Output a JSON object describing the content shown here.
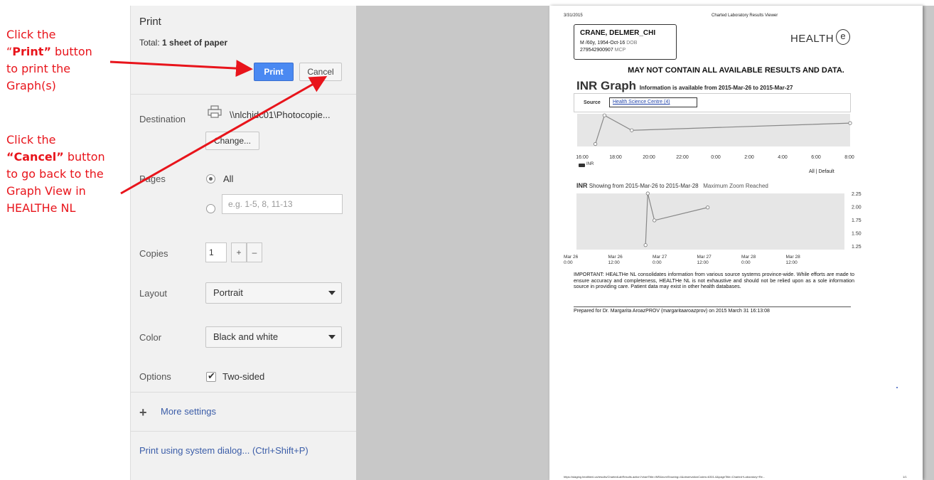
{
  "annotations": {
    "print_note": {
      "line1": "Click the",
      "line2_pre": "“",
      "line2_bold": "Print”",
      "line2_post": " button",
      "line3": "to print the",
      "line4": "Graph(s)"
    },
    "cancel_note": {
      "line1": "Click the",
      "line2_bold": "“Cancel”",
      "line2_post": " button",
      "line3": "to go back to the",
      "line4": "Graph View in",
      "line5": "HEALTHe NL"
    },
    "color": "#e8141b"
  },
  "print_panel": {
    "title": "Print",
    "total_prefix": "Total: ",
    "total_value": "1 sheet of paper",
    "print_button": "Print",
    "cancel_button": "Cancel",
    "destination_label": "Destination",
    "destination_value": "\\\\nlchidc01\\Photocopie...",
    "change_button": "Change...",
    "pages_label": "Pages",
    "pages_all": "All",
    "pages_placeholder": "e.g. 1-5, 8, 11-13",
    "copies_label": "Copies",
    "copies_value": "1",
    "copies_plus": "+",
    "copies_minus": "–",
    "layout_label": "Layout",
    "layout_value": "Portrait",
    "color_label": "Color",
    "color_value": "Black and white",
    "options_label": "Options",
    "options_two_sided": "Two-sided",
    "more_settings": "More settings",
    "system_dialog": "Print using system dialog... (Ctrl+Shift+P)",
    "accent_color": "#4a89f2"
  },
  "paper": {
    "date": "3/31/2015",
    "header_title": "Charted Laboratory Results Viewer",
    "patient_name": "CRANE, DELMER_CHI",
    "patient_info": "M /60y, 1954-Oct-16",
    "patient_info_suffix": "DOB",
    "patient_id": "279542900907",
    "patient_id_suffix": "MCP",
    "logo": "HEALTH",
    "logo_e": "e",
    "warning": "MAY NOT CONTAIN ALL AVAILABLE RESULTS AND DATA.",
    "graph_title": "INR Graph",
    "graph_subtitle": "Information is available from 2015-Mar-26 to 2015-Mar-27",
    "source_label": "Source",
    "source_value": "Health Science Centre (4)",
    "legend_inr": "INR",
    "all_default": "All | Default",
    "zoom_title_bold": "INR",
    "zoom_title": "Showing from 2015-Mar-26 to 2015-Mar-28",
    "zoom_note": "Maximum Zoom Reached",
    "important": "IMPORTANT: HEALTHe NL consolidates information from various source systems province-wide. While efforts are made to ensure accuracy and completeness, HEALTHe NL is not exhaustive and should not be relied upon as a sole information source in providing care. Patient data may exist in other health databases.",
    "prepared": "Prepared for Dr. Margarita AroazPROV (margaritaaroazprov) on 2015 March 31 16:13:08",
    "footer_url": "https://staging.healthenl.ca/results/ChartedLabResults.action?chartTitle=INR&numShowing=4&observationCodes=6301-6&pageTitle=Charted+Laboratory+Re...",
    "footer_page": "1/1"
  },
  "chart_data": [
    {
      "type": "line",
      "title": "INR Graph",
      "x_tick_labels": [
        "16:00",
        "18:00",
        "20:00",
        "22:00",
        "0:00",
        "2:00",
        "4:00",
        "6:00",
        "8:00"
      ],
      "x_hours": [
        15.2,
        15.8,
        17.6,
        32.0
      ],
      "series": [
        {
          "name": "INR",
          "values": [
            1.33,
            2.25,
            1.77,
            2.0
          ]
        }
      ],
      "ylim": [
        1.25,
        2.3
      ]
    },
    {
      "type": "line",
      "title": "INR Showing from 2015-Mar-26 to 2015-Mar-28",
      "x_tick_labels": [
        "Mar 26\n0:00",
        "Mar 26\n12:00",
        "Mar 27\n0:00",
        "Mar 27\n12:00",
        "Mar 28\n0:00",
        "Mar 28\n12:00"
      ],
      "x_hours": [
        15.2,
        15.8,
        17.6,
        32.0
      ],
      "series": [
        {
          "name": "INR",
          "values": [
            1.33,
            2.25,
            1.77,
            2.0
          ]
        }
      ],
      "y_tick_labels": [
        "2.25",
        "2.00",
        "1.75",
        "1.50",
        "1.25"
      ],
      "ylim": [
        1.25,
        2.25
      ]
    }
  ]
}
